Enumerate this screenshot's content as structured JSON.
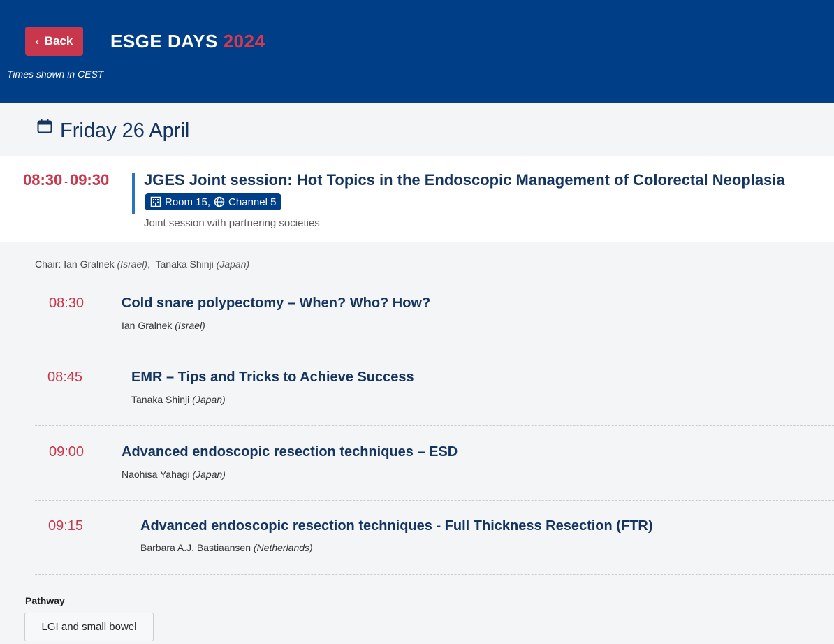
{
  "header": {
    "back_label": "Back",
    "brand_name": "ESGE DAYS",
    "brand_year": "2024",
    "timezone_note": "Times shown in CEST"
  },
  "day": {
    "title": "Friday 26 April"
  },
  "session": {
    "time_start": "08:30",
    "time_separator": "-",
    "time_end": "09:30",
    "title": "JGES Joint session: Hot Topics in the Endoscopic Management of Colorectal Neoplasia",
    "room": "Room 15,",
    "channel": "Channel 5",
    "subtitle": "Joint session with partnering societies",
    "chair_label": "Chair:",
    "chairs": [
      {
        "name": "Ian Gralnek",
        "country": "(Israel)",
        "sep": ","
      },
      {
        "name": "Tanaka Shinji",
        "country": "(Japan)",
        "sep": ""
      }
    ]
  },
  "talks": [
    {
      "time": "08:30",
      "title": "Cold snare polypectomy – When? Who? How?",
      "speaker": "Ian Gralnek",
      "country": "(Israel)"
    },
    {
      "time": "08:45",
      "title": "EMR – Tips and Tricks to Achieve Success",
      "speaker": "Tanaka Shinji",
      "country": "(Japan)"
    },
    {
      "time": "09:00",
      "title": "Advanced endoscopic resection techniques – ESD",
      "speaker": "Naohisa Yahagi",
      "country": "(Japan)"
    },
    {
      "time": "09:15",
      "title": "Advanced endoscopic resection techniques - Full Thickness Resection (FTR)",
      "speaker": "Barbara A.J. Bastiaansen",
      "country": "(Netherlands)"
    }
  ],
  "pathway": {
    "label": "Pathway",
    "tag": "LGI and small bowel"
  },
  "colors": {
    "header_bg": "#003f87",
    "accent_red": "#c8374c",
    "title_navy": "#15345f"
  }
}
